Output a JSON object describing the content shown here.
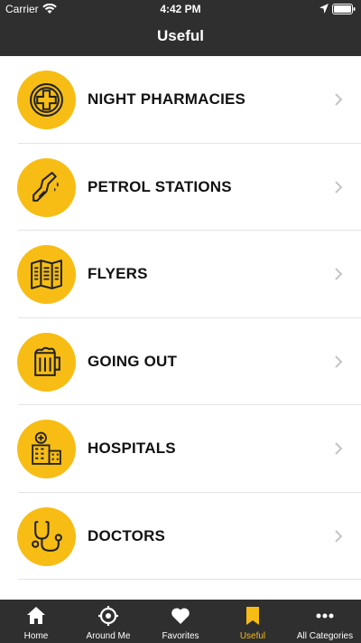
{
  "status": {
    "carrier": "Carrier",
    "time": "4:42 PM"
  },
  "nav": {
    "title": "Useful"
  },
  "items": [
    {
      "label": "NIGHT PHARMACIES",
      "icon": "pharmacy-cross-icon"
    },
    {
      "label": "PETROL STATIONS",
      "icon": "fuel-nozzle-icon"
    },
    {
      "label": "FLYERS",
      "icon": "flyer-map-icon"
    },
    {
      "label": "GOING OUT",
      "icon": "beer-mug-icon"
    },
    {
      "label": "HOSPITALS",
      "icon": "hospital-building-icon"
    },
    {
      "label": "DOCTORS",
      "icon": "stethoscope-icon"
    }
  ],
  "tabs": [
    {
      "label": "Home",
      "icon": "home-icon",
      "active": false
    },
    {
      "label": "Around Me",
      "icon": "target-icon",
      "active": false
    },
    {
      "label": "Favorites",
      "icon": "heart-icon",
      "active": false
    },
    {
      "label": "Useful",
      "icon": "bookmark-icon",
      "active": true
    },
    {
      "label": "All Categories",
      "icon": "more-dots-icon",
      "active": false
    }
  ],
  "colors": {
    "accent": "#f7bd14",
    "bar": "#2f2f2f"
  }
}
